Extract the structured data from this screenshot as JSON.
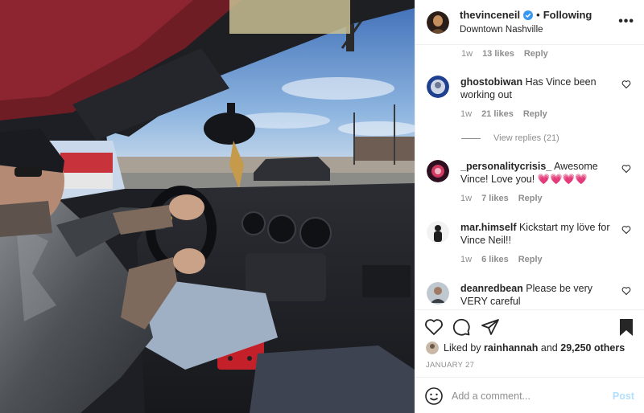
{
  "post": {
    "username": "thevinceneil",
    "follow_status": "Following",
    "separator": "•",
    "location": "Downtown Nashville",
    "more_icon": "more-horizontal-icon"
  },
  "comments": [
    {
      "id": "c0",
      "username": "",
      "text": "",
      "time": "1w",
      "likes": "13 likes",
      "reply": "Reply"
    },
    {
      "id": "c1",
      "username": "ghostobiwan",
      "text": "Has Vince been working out",
      "time": "1w",
      "likes": "21 likes",
      "reply": "Reply",
      "view_replies": "View replies (21)"
    },
    {
      "id": "c2",
      "username": "_personalitycrisis_",
      "text": "Awesome Vince! Love you! 💗💗💗💗",
      "time": "1w",
      "likes": "7 likes",
      "reply": "Reply"
    },
    {
      "id": "c3",
      "username": "mar.himself",
      "text": "Kickstart my löve for Vince Neil!!",
      "time": "1w",
      "likes": "6 likes",
      "reply": "Reply"
    },
    {
      "id": "c4",
      "username": "deanredbean",
      "text": "Please be very VERY careful",
      "time": "",
      "likes": "",
      "reply": ""
    }
  ],
  "likes_summary": {
    "prefix": "Liked by",
    "user": "rainhannah",
    "and": "and",
    "count": "29,250 others"
  },
  "date": "JANUARY 27",
  "add_comment": {
    "placeholder": "Add a comment...",
    "post_label": "Post"
  },
  "colors": {
    "accent": "#0095f6",
    "post_disabled": "#b2dffc",
    "verified": "#3897f0",
    "muted": "#8e8e8e"
  }
}
